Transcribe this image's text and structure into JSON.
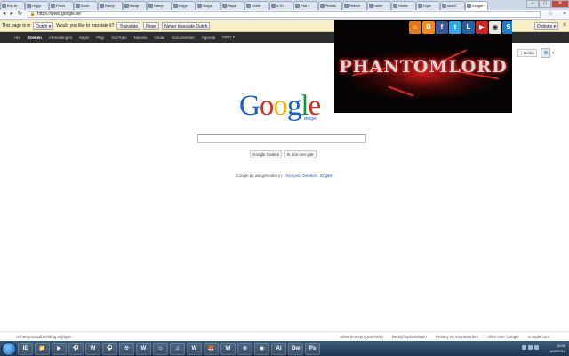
{
  "browser": {
    "tabs": [
      {
        "label": "Exp th"
      },
      {
        "label": "Legyy"
      },
      {
        "label": "Fetch"
      },
      {
        "label": "Gooli ."
      },
      {
        "label": "Ramp"
      },
      {
        "label": "Ramp"
      },
      {
        "label": "Ramp"
      },
      {
        "label": "Hdypi"
      },
      {
        "label": "Sorga"
      },
      {
        "label": "Playst"
      },
      {
        "label": "Dvmti"
      },
      {
        "label": "U.G's"
      },
      {
        "label": "Part 1"
      },
      {
        "label": "Phanto"
      },
      {
        "label": "Return"
      },
      {
        "label": "home"
      },
      {
        "label": "Home"
      },
      {
        "label": "Topic"
      },
      {
        "label": "searC"
      },
      {
        "label": "Google"
      }
    ],
    "url": "https://www.google.be",
    "window_controls": {
      "minimize": "–",
      "maximize": "□",
      "close": "✕"
    }
  },
  "translate_bar": {
    "prefix": "This page is in",
    "language": "Dutch ▾",
    "question": "Would you like to translate it?",
    "translate_btn": "Translate",
    "nope_btn": "Nope",
    "never_btn": "Never translate Dutch",
    "options": "Options ▾",
    "close": "✕"
  },
  "gbar": {
    "items": [
      "+Sd",
      "Zoeken",
      "Afbeeldingen",
      "Maps",
      "Play",
      "YouTube",
      "Nieuws",
      "Gmail",
      "Documenten",
      "Agenda",
      "Meer ▾"
    ]
  },
  "account": {
    "share_btn": "+ Delen",
    "caret": "▾"
  },
  "main": {
    "logo": {
      "letters": [
        "G",
        "o",
        "o",
        "g",
        "l",
        "e"
      ],
      "region": "België"
    },
    "search_value": "",
    "btn_search": "Google zoeken",
    "btn_lucky": "Ik doe een gok",
    "offered_text": "Google.be aangeboden in:",
    "languages": [
      "français",
      "Deutsch",
      "English"
    ]
  },
  "overlay": {
    "logo_text": "PHANTOMLORD",
    "icons": [
      {
        "name": "home-icon",
        "glyph": "⌂",
        "color": "#e07a1f"
      },
      {
        "name": "blogger-icon",
        "glyph": "B",
        "color": "#f08b1c"
      },
      {
        "name": "facebook-icon",
        "glyph": "f",
        "color": "#3b5998"
      },
      {
        "name": "twitter-icon",
        "glyph": "t",
        "color": "#2fa9e0"
      },
      {
        "name": "lastfm-icon",
        "glyph": "L",
        "color": "#2a5f9e"
      },
      {
        "name": "youtube-icon",
        "glyph": "▶",
        "color": "#cc2222"
      },
      {
        "name": "reddit-icon",
        "glyph": "◉",
        "color": "#e8e8e8"
      },
      {
        "name": "stumbleupon-icon",
        "glyph": "S",
        "color": "#1f7dcb"
      }
    ]
  },
  "footer": {
    "left": "Achtergrondafbeelding wijzigen",
    "links": [
      "Advertentieprogramma's",
      "Bedrijfsoplossingen",
      "Privacy en voorwaarden",
      "Alles over Google",
      "Google.com"
    ]
  },
  "taskbar": {
    "apps": [
      "IE",
      "📁",
      "▶",
      "⚽",
      "W",
      "⚽",
      "☢",
      "W",
      "☺",
      "♫",
      "W",
      "🦊",
      "W",
      "⊗",
      "◉",
      "Ai",
      "Dw",
      "Ps"
    ],
    "time": "12:00",
    "date": "1/09/2012"
  }
}
